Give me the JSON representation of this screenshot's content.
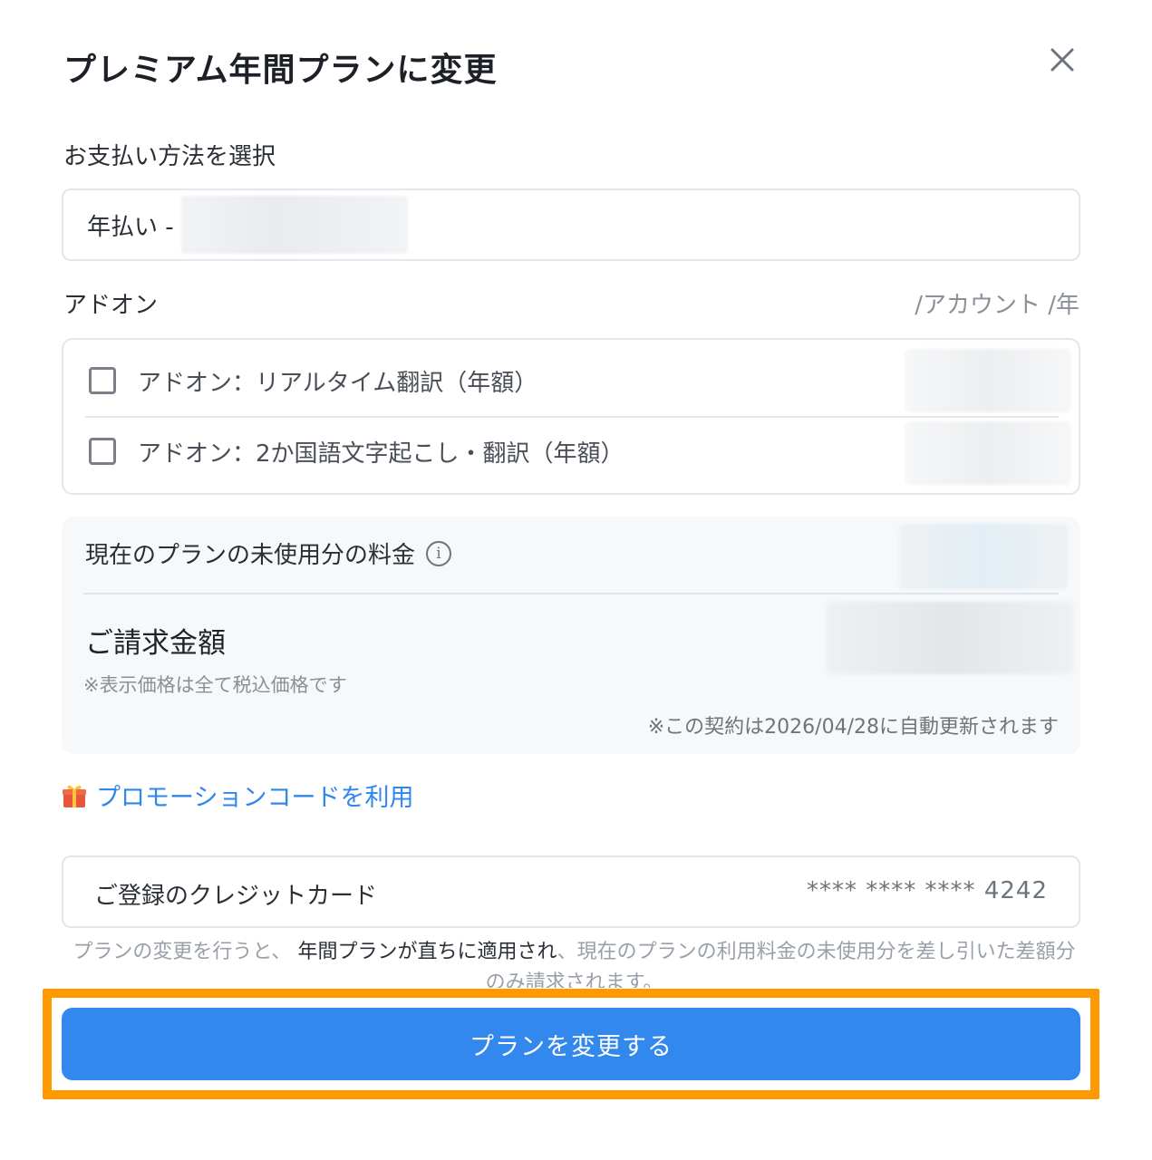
{
  "modal": {
    "title": "プレミアム年間プランに変更"
  },
  "payment": {
    "label": "お支払い方法を選択",
    "selected_prefix": "年払い -"
  },
  "addons": {
    "label": "アドオン",
    "unit_label": "/アカウント /年",
    "items": [
      {
        "label": "アドオン：リアルタイム翻訳（年額）",
        "checked": false
      },
      {
        "label": "アドオン：2か国語文字起こし・翻訳（年額）",
        "checked": false
      }
    ]
  },
  "summary": {
    "unused_label": "現在のプランの未使用分の料金",
    "total_label": "ご請求金額",
    "tax_note": "※表示価格は全て税込価格です",
    "renew_note": "※この契約は2026/04/28に自動更新されます"
  },
  "promo": {
    "label": "プロモーションコードを利用"
  },
  "card": {
    "label": "ご登録のクレジットカード",
    "number": "**** **** **** 4242"
  },
  "notice": {
    "part1": "プランの変更を行うと、",
    "part2": "年間プランが直ちに適用され",
    "part3": "、現在のプランの利用料金の未使用分を差し引いた差額分のみ請求されます。"
  },
  "cta": {
    "label": "プランを変更する"
  },
  "colors": {
    "primary": "#3388ee",
    "highlight": "#ff9900",
    "link": "#2f86eb"
  }
}
